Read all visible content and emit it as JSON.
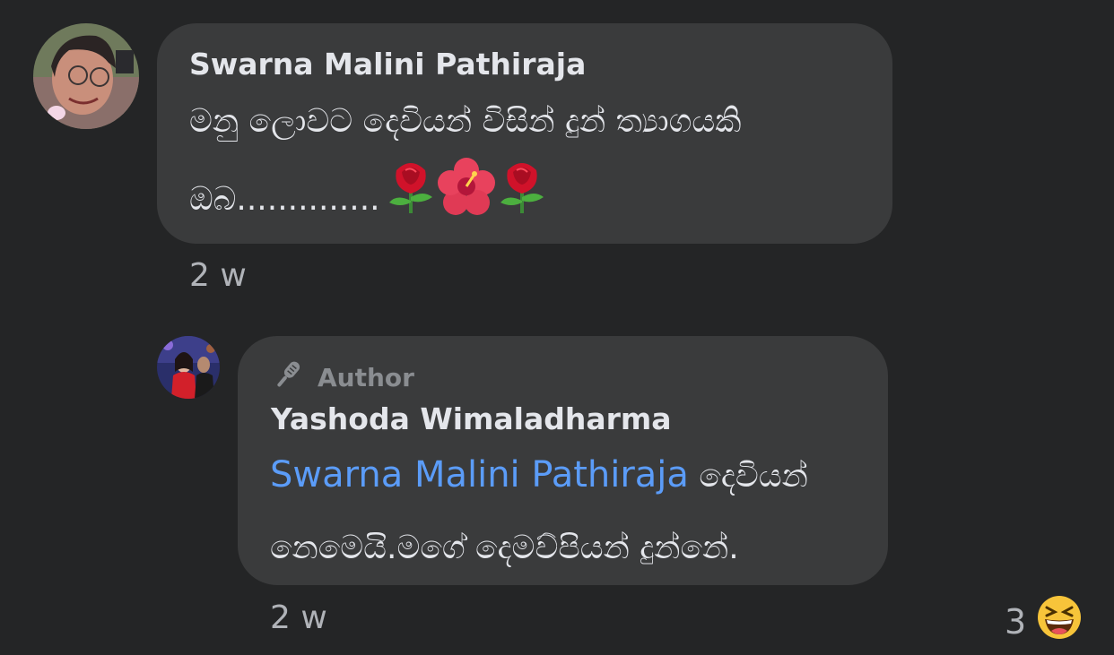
{
  "comments": [
    {
      "author": "Swarna Malini Pathiraja",
      "text_line1": "මනු ලොවට  දෙවියන්  විසින්  දුන් ත්‍යාගයකි",
      "text_line2": "ඔබ..............",
      "emojis": [
        "rose-icon",
        "hibiscus-icon",
        "rose-icon"
      ],
      "time": "2 w"
    }
  ],
  "reply": {
    "badge_label": "Author",
    "author": "Yashoda Wimaladharma",
    "mention": "Swarna Malini Pathiraja",
    "text_after_mention": " දෙවියන්",
    "text_line2": "නෙමෙයි.මගේ දෙමව්පියන් දුන්නේ.",
    "time": "2 w",
    "reaction_count": "3",
    "reaction_icon": "laughing-emoji-icon"
  },
  "colors": {
    "background": "#242526",
    "bubble": "#3a3b3c",
    "mention": "#5b9cf8",
    "meta": "#b0b3b8"
  }
}
